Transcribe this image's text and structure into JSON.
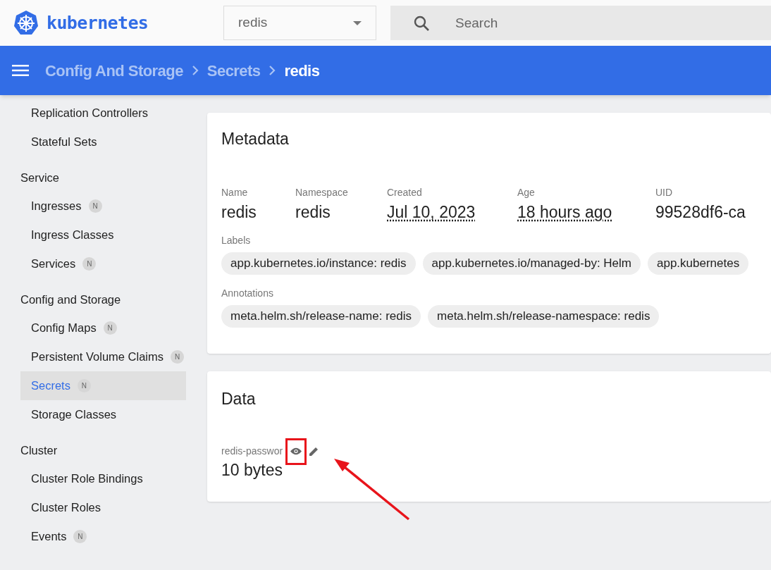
{
  "header": {
    "logo_text": "kubernetes",
    "namespace_select": "redis",
    "search": {
      "placeholder": "Search"
    }
  },
  "breadcrumbs": [
    {
      "label": "Config And Storage",
      "current": false
    },
    {
      "label": "Secrets",
      "current": false
    },
    {
      "label": "redis",
      "current": true
    }
  ],
  "sidebar": [
    {
      "kind": "item",
      "label": "Replication Controllers",
      "selected": false
    },
    {
      "kind": "item",
      "label": "Stateful Sets",
      "selected": false
    },
    {
      "kind": "section",
      "label": "Service"
    },
    {
      "kind": "item",
      "label": "Ingresses",
      "badge": "N",
      "selected": false
    },
    {
      "kind": "item",
      "label": "Ingress Classes",
      "selected": false
    },
    {
      "kind": "item",
      "label": "Services",
      "badge": "N",
      "selected": false
    },
    {
      "kind": "section",
      "label": "Config and Storage"
    },
    {
      "kind": "item",
      "label": "Config Maps",
      "badge": "N",
      "selected": false
    },
    {
      "kind": "item",
      "label": "Persistent Volume Claims",
      "badge": "N",
      "selected": false
    },
    {
      "kind": "item",
      "label": "Secrets",
      "badge": "N",
      "selected": true
    },
    {
      "kind": "item",
      "label": "Storage Classes",
      "selected": false
    },
    {
      "kind": "section",
      "label": "Cluster"
    },
    {
      "kind": "item",
      "label": "Cluster Role Bindings",
      "selected": false
    },
    {
      "kind": "item",
      "label": "Cluster Roles",
      "selected": false
    },
    {
      "kind": "item",
      "label": "Events",
      "badge": "N",
      "selected": false
    }
  ],
  "metadata": {
    "title": "Metadata",
    "fields": [
      {
        "label": "Name",
        "value": "redis",
        "dotted": false
      },
      {
        "label": "Namespace",
        "value": "redis",
        "dotted": false
      },
      {
        "label": "Created",
        "value": "Jul 10, 2023",
        "dotted": true
      },
      {
        "label": "Age",
        "value": "18 hours ago",
        "dotted": true
      },
      {
        "label": "UID",
        "value": "99528df6-ca",
        "dotted": false
      }
    ],
    "labels_title": "Labels",
    "labels": [
      "app.kubernetes.io/instance: redis",
      "app.kubernetes.io/managed-by: Helm",
      "app.kubernetes"
    ],
    "annotations_title": "Annotations",
    "annotations": [
      "meta.helm.sh/release-name: redis",
      "meta.helm.sh/release-namespace: redis"
    ]
  },
  "data": {
    "title": "Data",
    "entries": [
      {
        "key": "redis-passwor",
        "value": "10 bytes"
      }
    ]
  }
}
